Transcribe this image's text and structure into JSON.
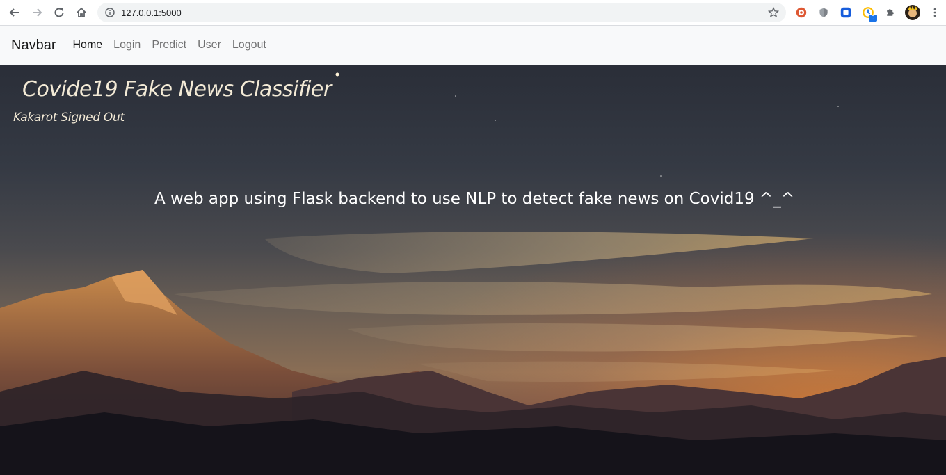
{
  "browser": {
    "url": "127.0.0.1:5000",
    "extensions": [
      "duckduckgo-icon",
      "shield-icon",
      "bitwarden-icon",
      "clock-extension-icon",
      "puzzle-icon"
    ],
    "extension_badge": "0"
  },
  "navbar": {
    "brand": "Navbar",
    "links": [
      "Home",
      "Login",
      "Predict",
      "User",
      "Logout"
    ],
    "active": "Home"
  },
  "hero": {
    "title": "Covide19 Fake News Classifier",
    "status": "Kakarot Signed Out",
    "tagline": "A web app using Flask backend to use NLP to detect fake news on Covid19 ^_^"
  },
  "colors": {
    "navbar_bg": "#f8f9fa",
    "omnibox_bg": "#f1f3f4",
    "hero_text": "#f3ead6"
  }
}
